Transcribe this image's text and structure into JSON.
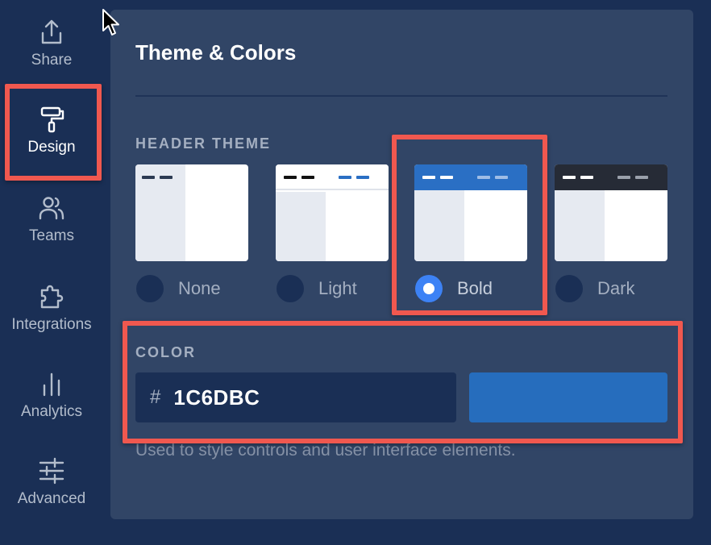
{
  "sidebar": {
    "items": [
      {
        "label": "Share",
        "icon": "share-icon"
      },
      {
        "label": "Design",
        "icon": "paint-roller-icon",
        "active": true
      },
      {
        "label": "Teams",
        "icon": "users-icon"
      },
      {
        "label": "Integrations",
        "icon": "puzzle-icon"
      },
      {
        "label": "Analytics",
        "icon": "bar-chart-icon"
      },
      {
        "label": "Advanced",
        "icon": "sliders-icon"
      }
    ]
  },
  "panel": {
    "title": "Theme & Colors",
    "header_theme": {
      "label": "HEADER THEME",
      "options": [
        {
          "label": "None",
          "selected": false
        },
        {
          "label": "Light",
          "selected": false
        },
        {
          "label": "Bold",
          "selected": true
        },
        {
          "label": "Dark",
          "selected": false
        }
      ]
    },
    "color": {
      "label": "COLOR",
      "hash": "#",
      "value": "1C6DBC",
      "swatch": "#266dbd",
      "helper": "Used to style controls and user interface elements."
    }
  },
  "colors": {
    "accent": "#3d82f5",
    "highlight": "#f0584f",
    "sidebar_bg": "#1a2f55",
    "panel_bg": "#314566"
  }
}
